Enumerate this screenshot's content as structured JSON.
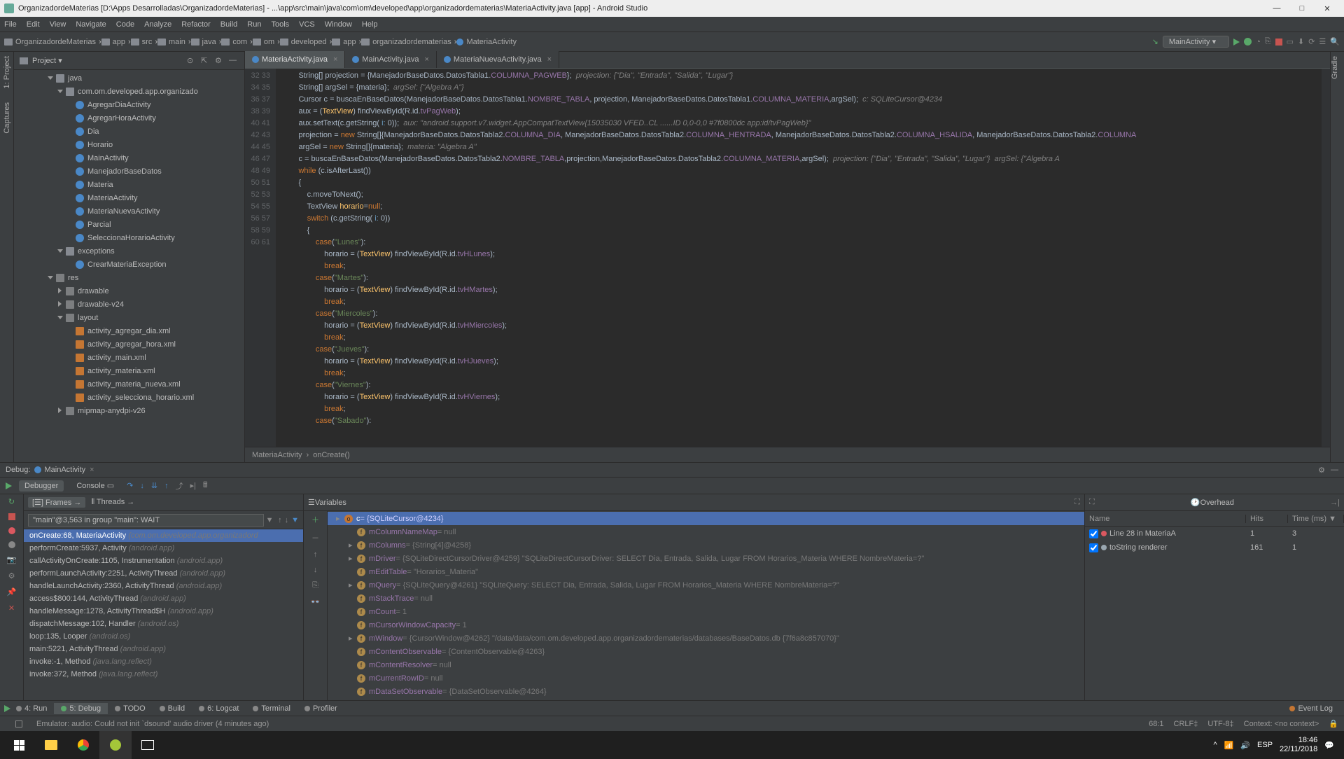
{
  "title": "OrganizadordeMaterias [D:\\Apps Desarrolladas\\OrganizadordeMaterias] - ...\\app\\src\\main\\java\\com\\om\\developed\\app\\organizadordematerias\\MateriaActivity.java [app] - Android Studio",
  "menu": [
    "File",
    "Edit",
    "View",
    "Navigate",
    "Code",
    "Analyze",
    "Refactor",
    "Build",
    "Run",
    "Tools",
    "VCS",
    "Window",
    "Help"
  ],
  "breadcrumbs": [
    "OrganizadordeMaterias",
    "app",
    "src",
    "main",
    "java",
    "com",
    "om",
    "developed",
    "app",
    "organizadordematerias",
    "MateriaActivity"
  ],
  "run_config": "MainActivity",
  "project_label": "Project",
  "side_tabs": [
    "1: Project",
    "Captures"
  ],
  "right_side_tab": "Gradle",
  "tree": [
    {
      "d": 3,
      "t": "open",
      "i": "pkg",
      "l": "java"
    },
    {
      "d": 4,
      "t": "open",
      "i": "pkg",
      "l": "com.om.developed.app.organizado"
    },
    {
      "d": 5,
      "t": "",
      "i": "cls",
      "l": "AgregarDiaActivity"
    },
    {
      "d": 5,
      "t": "",
      "i": "cls",
      "l": "AgregarHoraActivity"
    },
    {
      "d": 5,
      "t": "",
      "i": "cls",
      "l": "Dia"
    },
    {
      "d": 5,
      "t": "",
      "i": "cls",
      "l": "Horario"
    },
    {
      "d": 5,
      "t": "",
      "i": "cls",
      "l": "MainActivity"
    },
    {
      "d": 5,
      "t": "",
      "i": "cls",
      "l": "ManejadorBaseDatos"
    },
    {
      "d": 5,
      "t": "",
      "i": "cls",
      "l": "Materia"
    },
    {
      "d": 5,
      "t": "",
      "i": "cls",
      "l": "MateriaActivity"
    },
    {
      "d": 5,
      "t": "",
      "i": "cls",
      "l": "MateriaNuevaActivity"
    },
    {
      "d": 5,
      "t": "",
      "i": "cls",
      "l": "Parcial"
    },
    {
      "d": 5,
      "t": "",
      "i": "cls",
      "l": "SeleccionaHorarioActivity"
    },
    {
      "d": 4,
      "t": "open",
      "i": "pkg",
      "l": "exceptions"
    },
    {
      "d": 5,
      "t": "",
      "i": "cls",
      "l": "CrearMateriaException"
    },
    {
      "d": 3,
      "t": "open",
      "i": "folder",
      "l": "res"
    },
    {
      "d": 4,
      "t": "closed",
      "i": "folder",
      "l": "drawable"
    },
    {
      "d": 4,
      "t": "closed",
      "i": "folder",
      "l": "drawable-v24"
    },
    {
      "d": 4,
      "t": "open",
      "i": "folder",
      "l": "layout"
    },
    {
      "d": 5,
      "t": "",
      "i": "xml",
      "l": "activity_agregar_dia.xml"
    },
    {
      "d": 5,
      "t": "",
      "i": "xml",
      "l": "activity_agregar_hora.xml"
    },
    {
      "d": 5,
      "t": "",
      "i": "xml",
      "l": "activity_main.xml"
    },
    {
      "d": 5,
      "t": "",
      "i": "xml",
      "l": "activity_materia.xml"
    },
    {
      "d": 5,
      "t": "",
      "i": "xml",
      "l": "activity_materia_nueva.xml"
    },
    {
      "d": 5,
      "t": "",
      "i": "xml",
      "l": "activity_selecciona_horario.xml"
    },
    {
      "d": 4,
      "t": "closed",
      "i": "folder",
      "l": "mipmap-anydpi-v26"
    }
  ],
  "editor_tabs": [
    {
      "label": "MateriaActivity.java",
      "active": true
    },
    {
      "label": "MainActivity.java",
      "active": false
    },
    {
      "label": "MateriaNuevaActivity.java",
      "active": false
    }
  ],
  "line_start": 32,
  "line_end": 61,
  "code_lines": [
    "String[] projection = {ManejadorBaseDatos.DatosTabla1.<span class='fld'>COLUMNA_PAGWEB</span>};  <span class='cmt'>projection: {\"Dia\", \"Entrada\", \"Salida\", \"Lugar\"}</span>",
    "String[] argSel = {materia};  <span class='cmt'>argSel: {\"Algebra A\"}</span>",
    "Cursor c = buscaEnBaseDatos(ManejadorBaseDatos.DatosTabla1.<span class='fld'>NOMBRE_TABLA</span>, projection, ManejadorBaseDatos.DatosTabla1.<span class='fld'>COLUMNA_MATERIA</span>,argSel);  <span class='cmt'>c: SQLiteCursor@4234</span>",
    "aux = (<span class='id'>TextView</span>) findViewById(R.id.<span class='fld'>tvPagWeb</span>);",
    "aux.setText(c.getString( <span class='num'>i:</span> 0));  <span class='cmt'>aux: \"android.support.v7.widget.AppCompatTextView{15035030 VFED..CL ......ID 0,0-0,0 #7f0800dc app:id/tvPagWeb}\"</span>",
    "projection = <span class='kw'>new</span> String[]{ManejadorBaseDatos.DatosTabla2.<span class='fld'>COLUMNA_DIA</span>, ManejadorBaseDatos.DatosTabla2.<span class='fld'>COLUMNA_HENTRADA</span>, ManejadorBaseDatos.DatosTabla2.<span class='fld'>COLUMNA_HSALIDA</span>, ManejadorBaseDatos.DatosTabla2.<span class='fld'>COLUMNA</span>",
    "argSel = <span class='kw'>new</span> String[]{materia};  <span class='cmt'>materia: \"Algebra A\"</span>",
    "c = buscaEnBaseDatos(ManejadorBaseDatos.DatosTabla2.<span class='fld'>NOMBRE_TABLA</span>,projection,ManejadorBaseDatos.DatosTabla2.<span class='fld'>COLUMNA_MATERIA</span>,argSel);  <span class='cmt'>projection: {\"Dia\", \"Entrada\", \"Salida\", \"Lugar\"}  argSel: {\"Algebra A</span>",
    "<span class='kw'>while</span> (c.isAfterLast())",
    "{",
    "    c.moveToNext();",
    "    TextView <span class='id'>horario</span>=<span class='kw'>null</span>;",
    "    <span class='kw'>switch</span> (c.getString( <span class='num'>i:</span> 0))",
    "    {",
    "        <span class='kw'>case</span>(<span class='str'>\"Lunes\"</span>):",
    "            horario = (<span class='id'>TextView</span>) findViewById(R.id.<span class='fld'>tvHLunes</span>);",
    "            <span class='kw'>break</span>;",
    "        <span class='kw'>case</span>(<span class='str'>\"Martes\"</span>):",
    "            horario = (<span class='id'>TextView</span>) findViewById(R.id.<span class='fld'>tvHMartes</span>);",
    "            <span class='kw'>break</span>;",
    "        <span class='kw'>case</span>(<span class='str'>\"Miercoles\"</span>):",
    "            horario = (<span class='id'>TextView</span>) findViewById(R.id.<span class='fld'>tvHMiercoles</span>);",
    "            <span class='kw'>break</span>;",
    "        <span class='kw'>case</span>(<span class='str'>\"Jueves\"</span>):",
    "            horario = (<span class='id'>TextView</span>) findViewById(R.id.<span class='fld'>tvHJueves</span>);",
    "            <span class='kw'>break</span>;",
    "        <span class='kw'>case</span>(<span class='str'>\"Viernes\"</span>):",
    "            horario = (<span class='id'>TextView</span>) findViewById(R.id.<span class='fld'>tvHViernes</span>);",
    "            <span class='kw'>break</span>;",
    "        <span class='kw'>case</span>(<span class='str'>\"Sabado\"</span>):"
  ],
  "crumb_editor": [
    "MateriaActivity",
    "onCreate()"
  ],
  "debug": {
    "label": "Debug:",
    "session": "MainActivity",
    "tabs": [
      "Debugger",
      "Console"
    ],
    "frames_label": "Frames",
    "threads_label": "Threads",
    "thread_combo": "\"main\"@3,563 in group \"main\": WAIT",
    "frames": [
      {
        "m": "onCreate:68, MateriaActivity",
        "p": "(com.om.developed.app.organizadord",
        "sel": true
      },
      {
        "m": "performCreate:5937, Activity",
        "p": "(android.app)"
      },
      {
        "m": "callActivityOnCreate:1105, Instrumentation",
        "p": "(android.app)"
      },
      {
        "m": "performLaunchActivity:2251, ActivityThread",
        "p": "(android.app)"
      },
      {
        "m": "handleLaunchActivity:2360, ActivityThread",
        "p": "(android.app)"
      },
      {
        "m": "access$800:144, ActivityThread",
        "p": "(android.app)"
      },
      {
        "m": "handleMessage:1278, ActivityThread$H",
        "p": "(android.app)"
      },
      {
        "m": "dispatchMessage:102, Handler",
        "p": "(android.os)"
      },
      {
        "m": "loop:135, Looper",
        "p": "(android.os)"
      },
      {
        "m": "main:5221, ActivityThread",
        "p": "(android.app)"
      },
      {
        "m": "invoke:-1, Method",
        "p": "(java.lang.reflect)"
      },
      {
        "m": "invoke:372, Method",
        "p": "(java.lang.reflect)"
      }
    ],
    "variables_label": "Variables",
    "vars": [
      {
        "ind": 0,
        "exp": true,
        "ico": "o",
        "n": "c",
        "v": "= {SQLiteCursor@4234}",
        "sel": true
      },
      {
        "ind": 1,
        "exp": false,
        "ico": "f",
        "n": "mColumnNameMap",
        "v": "= null"
      },
      {
        "ind": 1,
        "exp": true,
        "ico": "f",
        "n": "mColumns",
        "v": "= {String[4]@4258}"
      },
      {
        "ind": 1,
        "exp": true,
        "ico": "f",
        "n": "mDriver",
        "v": "= {SQLiteDirectCursorDriver@4259} \"SQLiteDirectCursorDriver: SELECT Dia, Entrada, Salida, Lugar FROM Horarios_Materia WHERE NombreMateria=?\""
      },
      {
        "ind": 1,
        "exp": false,
        "ico": "f",
        "n": "mEditTable",
        "v": "= \"Horarios_Materia\""
      },
      {
        "ind": 1,
        "exp": true,
        "ico": "f",
        "n": "mQuery",
        "v": "= {SQLiteQuery@4261} \"SQLiteQuery: SELECT Dia, Entrada, Salida, Lugar FROM Horarios_Materia WHERE NombreMateria=?\""
      },
      {
        "ind": 1,
        "exp": false,
        "ico": "f",
        "n": "mStackTrace",
        "v": "= null"
      },
      {
        "ind": 1,
        "exp": false,
        "ico": "f",
        "n": "mCount",
        "v": "= 1"
      },
      {
        "ind": 1,
        "exp": false,
        "ico": "f",
        "n": "mCursorWindowCapacity",
        "v": "= 1"
      },
      {
        "ind": 1,
        "exp": true,
        "ico": "f",
        "n": "mWindow",
        "v": "= {CursorWindow@4262} \"/data/data/com.om.developed.app.organizadordematerias/databases/BaseDatos.db {7f6a8c857070}\""
      },
      {
        "ind": 1,
        "exp": false,
        "ico": "f",
        "n": "mContentObservable",
        "v": "= {ContentObservable@4263}"
      },
      {
        "ind": 1,
        "exp": false,
        "ico": "f",
        "n": "mContentResolver",
        "v": "= null"
      },
      {
        "ind": 1,
        "exp": false,
        "ico": "f",
        "n": "mCurrentRowID",
        "v": "= null"
      },
      {
        "ind": 1,
        "exp": false,
        "ico": "f",
        "n": "mDataSetObservable",
        "v": "= {DataSetObservable@4264}"
      }
    ],
    "overhead_label": "Overhead",
    "ov_cols": [
      "Name",
      "Hits",
      "Time (ms)"
    ],
    "ov_rows": [
      {
        "c": true,
        "color": "#db5860",
        "n": "Line 28 in MateriaA",
        "h": "1",
        "t": "3"
      },
      {
        "c": true,
        "color": "#9aa7b0",
        "n": "toString renderer",
        "h": "161",
        "t": "1"
      }
    ]
  },
  "bottom_tabs": [
    {
      "l": "4: Run",
      "ico": "run"
    },
    {
      "l": "5: Debug",
      "ico": "bug",
      "active": true
    },
    {
      "l": "TODO",
      "ico": "check"
    },
    {
      "l": "Build",
      "ico": "hammer"
    },
    {
      "l": "6: Logcat",
      "ico": "log"
    },
    {
      "l": "Terminal",
      "ico": "term"
    },
    {
      "l": "Profiler",
      "ico": "prof"
    }
  ],
  "event_log": "Event Log",
  "status_msg": "Emulator: audio: Could not init `dsound' audio driver (4 minutes ago)",
  "status_right": [
    "68:1",
    "CRLF‡",
    "UTF-8‡",
    "Context: <no context>"
  ],
  "taskbar": {
    "lang": "ESP",
    "time": "18:46",
    "date": "22/11/2018"
  }
}
